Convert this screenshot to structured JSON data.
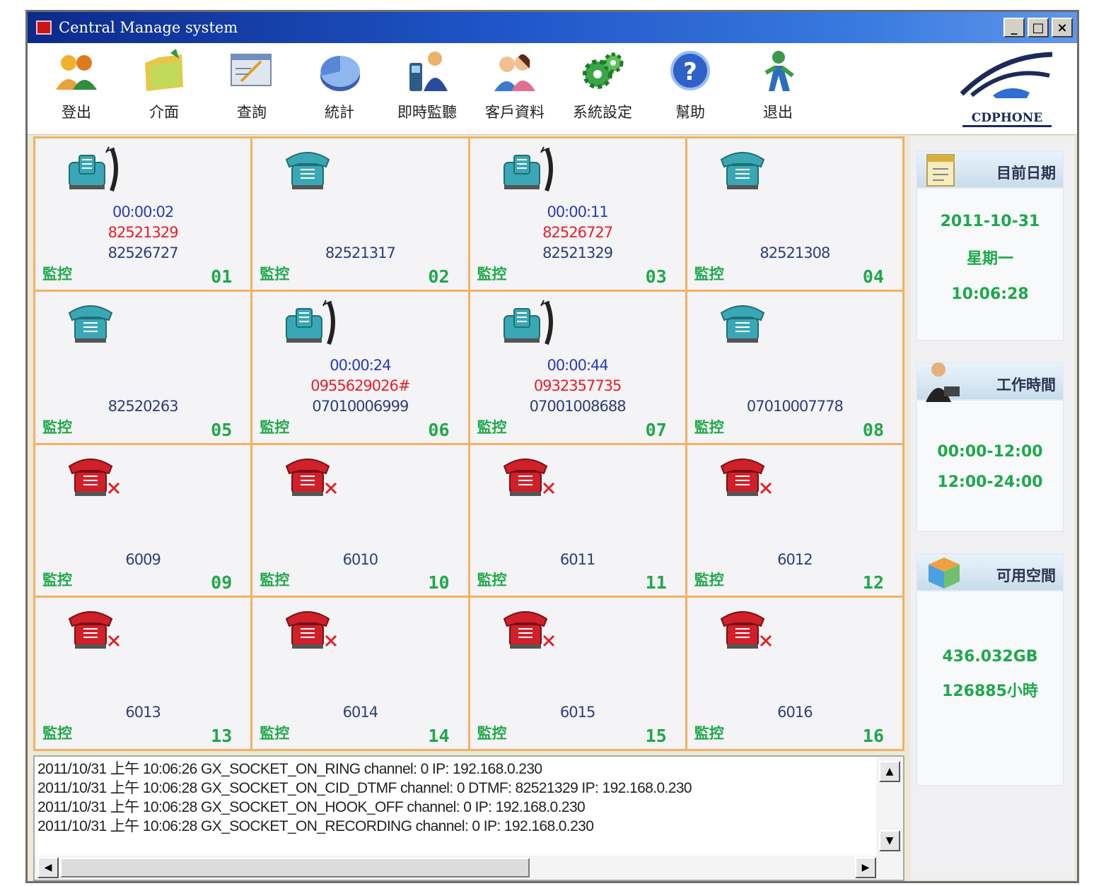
{
  "window": {
    "title": "Central Manage system"
  },
  "title_buttons": {
    "minimize": "_",
    "maximize": "□",
    "close": "×"
  },
  "toolbar": {
    "items": [
      {
        "label": "登出",
        "icon": "users-logout-icon"
      },
      {
        "label": "介面",
        "icon": "folder-interface-icon"
      },
      {
        "label": "查詢",
        "icon": "query-form-icon"
      },
      {
        "label": "統計",
        "icon": "pie-chart-icon"
      },
      {
        "label": "即時監聽",
        "icon": "live-monitor-icon"
      },
      {
        "label": "客戶資料",
        "icon": "customers-icon"
      },
      {
        "label": "系統設定",
        "icon": "gear-settings-icon"
      },
      {
        "label": "幫助",
        "icon": "help-icon"
      },
      {
        "label": "退出",
        "icon": "exit-icon"
      }
    ],
    "logo_text": "CDPHONE"
  },
  "channels": [
    {
      "ch": "01",
      "status": "offhook",
      "duration": "00:00:02",
      "caller": "82521329",
      "number": "82526727",
      "monitor": "監控"
    },
    {
      "ch": "02",
      "status": "idle",
      "duration": "",
      "caller": "",
      "number": "82521317",
      "monitor": "監控"
    },
    {
      "ch": "03",
      "status": "offhook",
      "duration": "00:00:11",
      "caller": "82526727",
      "number": "82521329",
      "monitor": "監控"
    },
    {
      "ch": "04",
      "status": "idle",
      "duration": "",
      "caller": "",
      "number": "82521308",
      "monitor": "監控"
    },
    {
      "ch": "05",
      "status": "idle",
      "duration": "",
      "caller": "",
      "number": "82520263",
      "monitor": "監控"
    },
    {
      "ch": "06",
      "status": "offhook",
      "duration": "00:00:24",
      "caller": "0955629026#",
      "number": "07010006999",
      "monitor": "監控"
    },
    {
      "ch": "07",
      "status": "offhook",
      "duration": "00:00:44",
      "caller": "0932357735",
      "number": "07001008688",
      "monitor": "監控"
    },
    {
      "ch": "08",
      "status": "idle",
      "duration": "",
      "caller": "",
      "number": "07010007778",
      "monitor": "監控"
    },
    {
      "ch": "09",
      "status": "disconnected",
      "duration": "",
      "caller": "",
      "number": "6009",
      "monitor": "監控"
    },
    {
      "ch": "10",
      "status": "disconnected",
      "duration": "",
      "caller": "",
      "number": "6010",
      "monitor": "監控"
    },
    {
      "ch": "11",
      "status": "disconnected",
      "duration": "",
      "caller": "",
      "number": "6011",
      "monitor": "監控"
    },
    {
      "ch": "12",
      "status": "disconnected",
      "duration": "",
      "caller": "",
      "number": "6012",
      "monitor": "監控"
    },
    {
      "ch": "13",
      "status": "disconnected",
      "duration": "",
      "caller": "",
      "number": "6013",
      "monitor": "監控"
    },
    {
      "ch": "14",
      "status": "disconnected",
      "duration": "",
      "caller": "",
      "number": "6014",
      "monitor": "監控"
    },
    {
      "ch": "15",
      "status": "disconnected",
      "duration": "",
      "caller": "",
      "number": "6015",
      "monitor": "監控"
    },
    {
      "ch": "16",
      "status": "disconnected",
      "duration": "",
      "caller": "",
      "number": "6016",
      "monitor": "監控"
    }
  ],
  "sidebar": {
    "date_panel": {
      "title": "目前日期",
      "date": "2011-10-31",
      "weekday": "星期一",
      "time": "10:06:28"
    },
    "work_panel": {
      "title": "工作時間",
      "slot1": "00:00-12:00",
      "slot2": "12:00-24:00"
    },
    "space_panel": {
      "title": "可用空間",
      "size": "436.032GB",
      "hours": "126885小時"
    }
  },
  "log": {
    "lines": [
      "2011/10/31 上午 10:06:26 GX_SOCKET_ON_RING channel: 0 IP: 192.168.0.230",
      "2011/10/31 上午 10:06:28 GX_SOCKET_ON_CID_DTMF channel: 0 DTMF: 82521329 IP: 192.168.0.230",
      "2011/10/31 上午 10:06:28 GX_SOCKET_ON_HOOK_OFF channel: 0 IP: 192.168.0.230",
      "2011/10/31 上午 10:06:28 GX_SOCKET_ON_RECORDING channel: 0 IP: 192.168.0.230"
    ]
  },
  "colors": {
    "accent_border": "#f2b265",
    "monitor_green": "#1fa84a",
    "caller_red": "#e5202a",
    "duration_blue": "#2a3cb5"
  }
}
